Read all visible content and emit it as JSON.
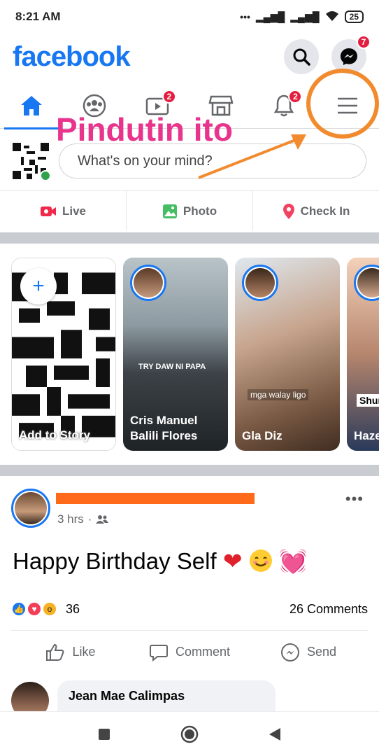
{
  "status_bar": {
    "time": "8:21 AM",
    "battery": "25"
  },
  "header": {
    "logo": "facebook",
    "messenger_badge": "7"
  },
  "nav": {
    "items": [
      {
        "name": "home",
        "badge": ""
      },
      {
        "name": "groups",
        "badge": ""
      },
      {
        "name": "watch",
        "badge": "2"
      },
      {
        "name": "marketplace",
        "badge": ""
      },
      {
        "name": "notifications",
        "badge": "2"
      },
      {
        "name": "menu",
        "badge": ""
      }
    ]
  },
  "composer": {
    "placeholder": "What's on your mind?"
  },
  "actions": {
    "live": "Live",
    "photo": "Photo",
    "checkin": "Check In"
  },
  "stories": {
    "add_label": "Add to Story",
    "items": [
      {
        "name": "Cris Manuel\nBalili Flores",
        "caption": "TRY DAW NI PAPA"
      },
      {
        "name": "Gla Diz",
        "caption": "mga walay ligo"
      },
      {
        "name": "Haze",
        "caption": "Shun"
      }
    ]
  },
  "post": {
    "time": "3 hrs",
    "text": "Happy Birthday Self",
    "reaction_count": "36",
    "comments": "26 Comments",
    "like": "Like",
    "comment": "Comment",
    "send": "Send"
  },
  "comment_preview": {
    "author": "Jean Mae Calimpas"
  },
  "overlay": {
    "instruction": "Pindutin ito"
  },
  "colors": {
    "brand": "#1877F2",
    "badge": "#E41E3F",
    "annotation_text": "#E8348C",
    "annotation_mark": "#F28A2E"
  }
}
